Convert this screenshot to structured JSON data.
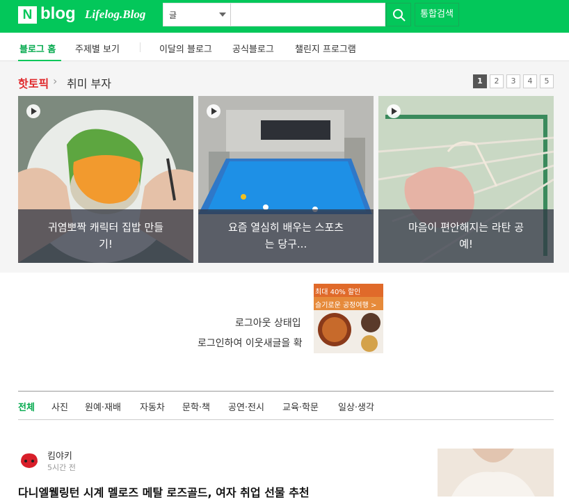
{
  "header": {
    "logo_n": "N",
    "logo_blog": "blog",
    "logo_lifelog": "Lifelog.Blog",
    "search_select": "글",
    "search_value": "",
    "search_button_icon": "search-icon",
    "total_search": "통합검색",
    "brand_color": "#03c75a"
  },
  "nav": {
    "items": [
      "블로그 홈",
      "주제별 보기",
      "이달의 블로그",
      "공식블로그",
      "챌린지 프로그램"
    ]
  },
  "hot": {
    "title": "핫토픽",
    "subtitle": "취미 부자",
    "pages": [
      "1",
      "2",
      "3",
      "4",
      "5"
    ],
    "active_page": "1",
    "cards": [
      {
        "caption": "귀염뽀짝 캐릭터 집밥 만들기!"
      },
      {
        "caption": "요즘 열심히 배우는 스포츠는 당구..."
      },
      {
        "caption": "마음이 편안해지는 라탄 공예!"
      }
    ]
  },
  "login_notice": {
    "line1": "로그아웃 상태입",
    "line2": "로그인하여 이웃새글을 확"
  },
  "ad": {
    "line1": "최대 40% 할인",
    "line2": "슬기로운 공정여행 >"
  },
  "categories": [
    "전체",
    "사진",
    "원예·재배",
    "자동차",
    "문학·책",
    "공연·전시",
    "교육·학문",
    "일상·생각"
  ],
  "post": {
    "author": "킴야키",
    "time": "5시간 전",
    "title": "다니엘웰링턴 시계 멜로즈 메탈 로즈골드, 여자 취업 선물 추천"
  }
}
